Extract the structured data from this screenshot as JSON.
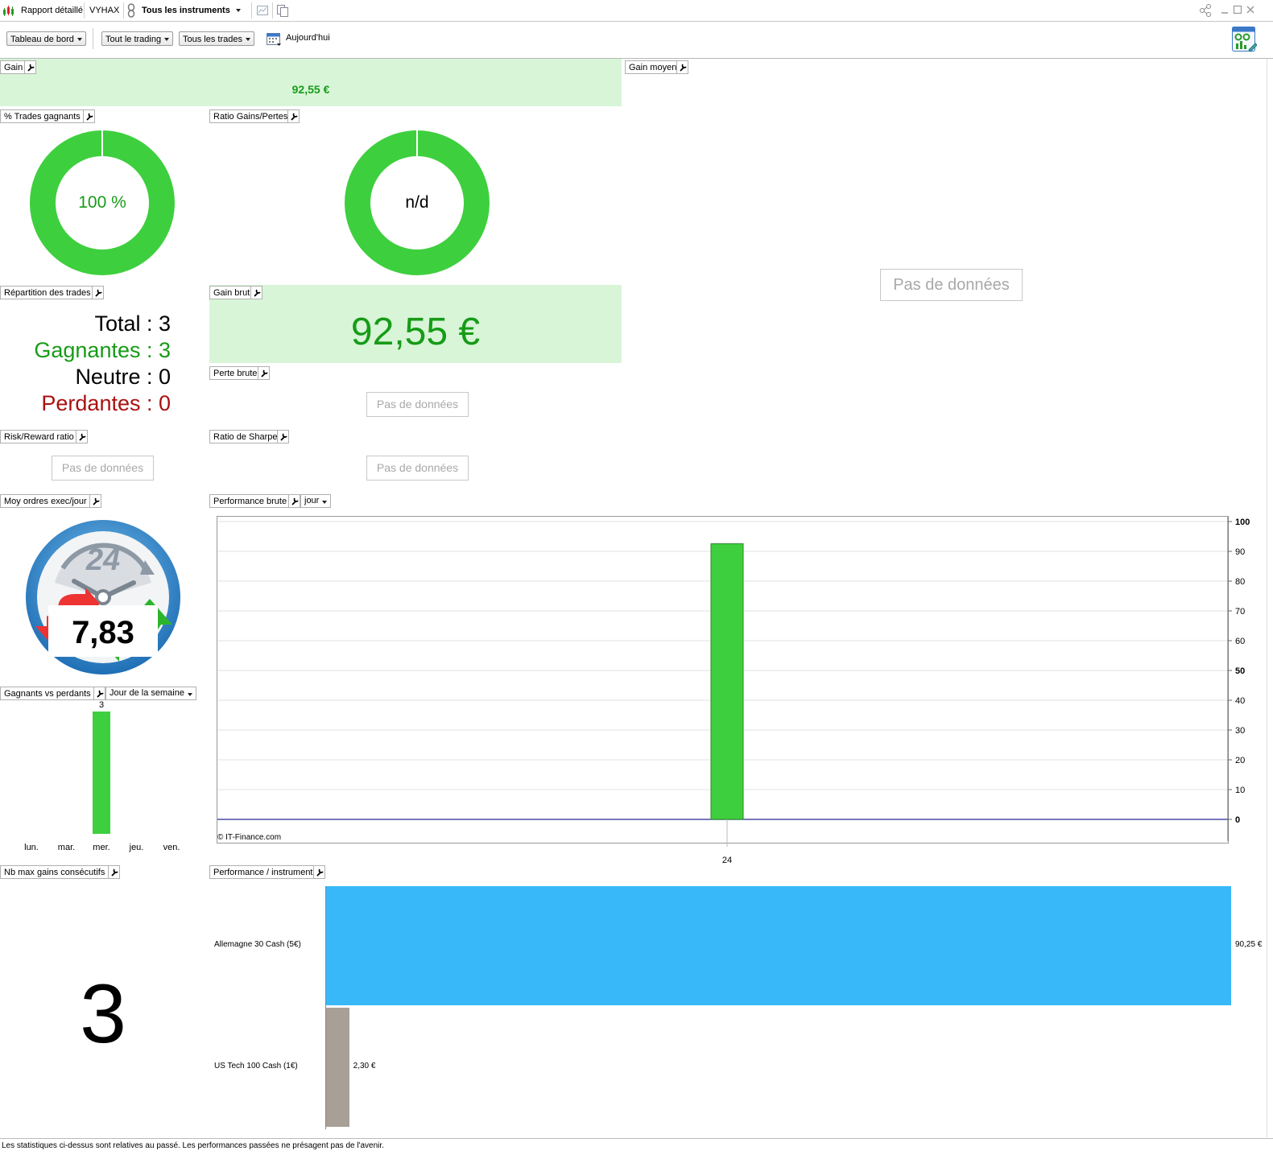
{
  "titlebar": {
    "tab_report": "Rapport détaillé",
    "tab_account": "VYHAX",
    "instrument_selector": "Tous les instruments"
  },
  "toolbar": {
    "dashboard": "Tableau de bord",
    "trading_filter": "Tout le trading",
    "trades_filter": "Tous les trades",
    "date_label": "Aujourd'hui"
  },
  "widgets": {
    "gain": {
      "title": "Gain",
      "value": "92,55 €"
    },
    "avg_gain": {
      "title": "Gain moyen",
      "nodata": "Pas de données"
    },
    "win_pct": {
      "title": "% Trades gagnants",
      "value": "100 %",
      "fraction": 1.0
    },
    "ratio": {
      "title": "Ratio Gains/Pertes",
      "value": "n/d"
    },
    "distribution": {
      "title": "Répartition des trades",
      "total": "Total : 3",
      "winners": "Gagnantes : 3",
      "neutral": "Neutre : 0",
      "losers": "Perdantes : 0"
    },
    "gross_gain": {
      "title": "Gain brut",
      "value": "92,55 €"
    },
    "gross_loss": {
      "title": "Perte brute",
      "nodata": "Pas de données"
    },
    "risk_reward": {
      "title": "Risk/Reward ratio",
      "nodata": "Pas de données"
    },
    "sharpe": {
      "title": "Ratio de Sharpe",
      "nodata": "Pas de données"
    },
    "orders_per_day": {
      "title": "Moy ordres exec/jour",
      "clock_label": "24",
      "value": "7,83"
    },
    "gross_perf": {
      "title": "Performance brute",
      "period": "jour",
      "copyright": "© IT-Finance.com"
    },
    "win_vs_loss": {
      "title": "Gagnants vs perdants",
      "period": "Jour de la semaine"
    },
    "max_consec": {
      "title": "Nb max gains consécutifs",
      "value": "3"
    },
    "perf_instrument": {
      "title": "Performance / instrument"
    }
  },
  "colors": {
    "green": "#3ecf3e",
    "green_text": "#179b17",
    "red_text": "#a11",
    "blue_bar": "#38b8f8",
    "gray_bar": "#a89f96",
    "green_panel": "#d8f5d8"
  },
  "chart_data": [
    {
      "type": "bar",
      "categories": [
        "24"
      ],
      "values": [
        92.55
      ],
      "ylim": [
        0,
        100
      ],
      "yticks": [
        0,
        10,
        20,
        30,
        40,
        50,
        60,
        70,
        80,
        90,
        100
      ]
    },
    {
      "type": "bar",
      "categories": [
        "lun.",
        "mar.",
        "mer.",
        "jeu.",
        "ven."
      ],
      "values": [
        0,
        0,
        3,
        0,
        0
      ],
      "labels": [
        "",
        "",
        "3",
        "",
        ""
      ]
    },
    {
      "type": "bar",
      "orientation": "horizontal",
      "categories": [
        "Allemagne 30 Cash (5€)",
        "US Tech 100 Cash (1€)"
      ],
      "values": [
        90.25,
        2.3
      ],
      "labels": [
        "90,25 €",
        "2,30 €"
      ]
    }
  ],
  "footer": {
    "disclaimer": "Les statistiques ci-dessus sont relatives au passé. Les performances passées ne présagent pas de l'avenir."
  }
}
